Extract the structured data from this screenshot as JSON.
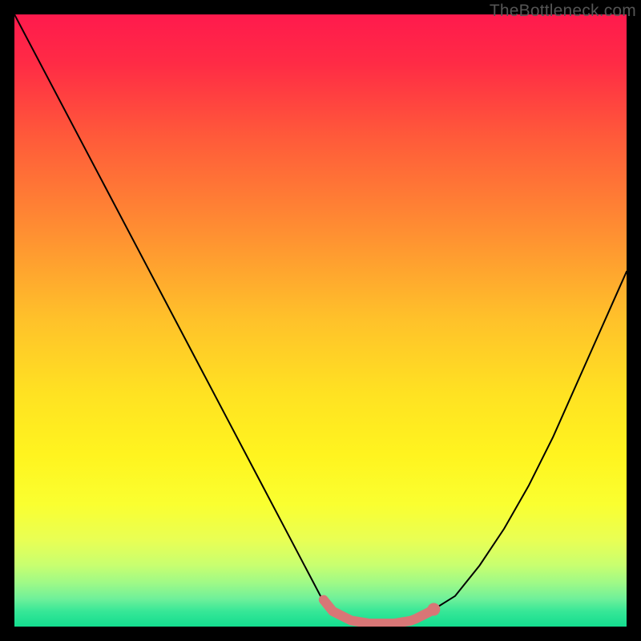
{
  "watermark": "TheBottleneck.com",
  "chart_data": {
    "type": "line",
    "title": "",
    "xlabel": "",
    "ylabel": "",
    "xlim": [
      0,
      100
    ],
    "ylim": [
      0,
      100
    ],
    "series": [
      {
        "name": "bottleneck-curve",
        "x": [
          0,
          5,
          10,
          15,
          20,
          25,
          30,
          35,
          40,
          45,
          50,
          52,
          55,
          58,
          62,
          65,
          68,
          72,
          76,
          80,
          84,
          88,
          92,
          96,
          100
        ],
        "y": [
          100,
          90.5,
          81,
          71.5,
          62,
          52.5,
          43,
          33.5,
          24,
          14.5,
          5,
          2.5,
          1,
          0.5,
          0.5,
          1,
          2.5,
          5,
          10,
          16,
          23,
          31,
          40,
          49,
          58
        ],
        "min_range_x": [
          50.5,
          68.5
        ],
        "min_dot_x": 68.5,
        "color_line": "#000000",
        "color_marker": "#d87676"
      }
    ],
    "gradient_stops": [
      {
        "t": 0.0,
        "color": "#ff1a4d"
      },
      {
        "t": 0.08,
        "color": "#ff2b45"
      },
      {
        "t": 0.2,
        "color": "#ff5a3a"
      },
      {
        "t": 0.35,
        "color": "#ff8d32"
      },
      {
        "t": 0.5,
        "color": "#ffc22a"
      },
      {
        "t": 0.62,
        "color": "#ffe222"
      },
      {
        "t": 0.72,
        "color": "#fff41f"
      },
      {
        "t": 0.8,
        "color": "#faff30"
      },
      {
        "t": 0.86,
        "color": "#e8ff55"
      },
      {
        "t": 0.9,
        "color": "#c8ff70"
      },
      {
        "t": 0.93,
        "color": "#9cf988"
      },
      {
        "t": 0.955,
        "color": "#6ef09a"
      },
      {
        "t": 0.975,
        "color": "#37e797"
      },
      {
        "t": 1.0,
        "color": "#13dd8f"
      }
    ]
  }
}
